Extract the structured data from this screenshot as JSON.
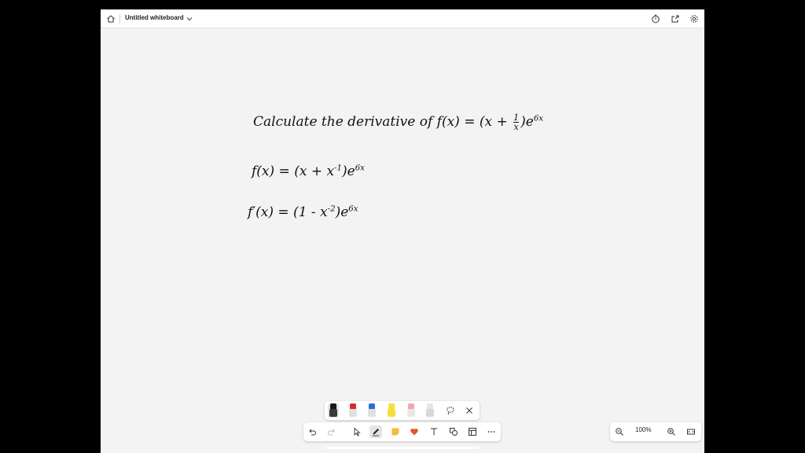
{
  "header": {
    "title": "Untitled whiteboard",
    "icons": [
      "home-icon",
      "chevron-down-icon",
      "timer-icon",
      "share-icon",
      "settings-icon"
    ]
  },
  "board": {
    "line1": "Calculate the derivative of f(x) = (x + ",
    "line1_fraction_num": "1",
    "line1_fraction_den": "x",
    "line1_end": ")e",
    "line1_exp": "6x",
    "line2": "f(x) = (x + x",
    "line2_exp1": "-1",
    "line2_end": ")e",
    "line2_exp2": "6x",
    "line3": "f′(x) = (1 - x",
    "line3_exp1": "-2",
    "line3_end": ")e",
    "line3_exp2": "6x"
  },
  "pen_tray": {
    "pens": [
      {
        "name": "black",
        "color": "#1a1a1a"
      },
      {
        "name": "red",
        "color": "#d92b2b"
      },
      {
        "name": "blue",
        "color": "#2a6fd1"
      },
      {
        "name": "yellow",
        "color": "#f4e03a"
      },
      {
        "name": "pink",
        "color": "#f0a6b0"
      },
      {
        "name": "eraser",
        "color": "#e6e6e6"
      }
    ],
    "icons": [
      "lasso-icon",
      "close-icon"
    ]
  },
  "toolbar": {
    "icons": [
      "undo-icon",
      "redo-icon",
      "select-icon",
      "pen-icon",
      "sticky-note-icon",
      "reaction-icon",
      "text-icon",
      "shapes-icon",
      "template-icon",
      "more-icon"
    ]
  },
  "zoom": {
    "level": "100%",
    "icons": [
      "zoom-out-icon",
      "zoom-in-icon",
      "fit-screen-icon"
    ]
  }
}
